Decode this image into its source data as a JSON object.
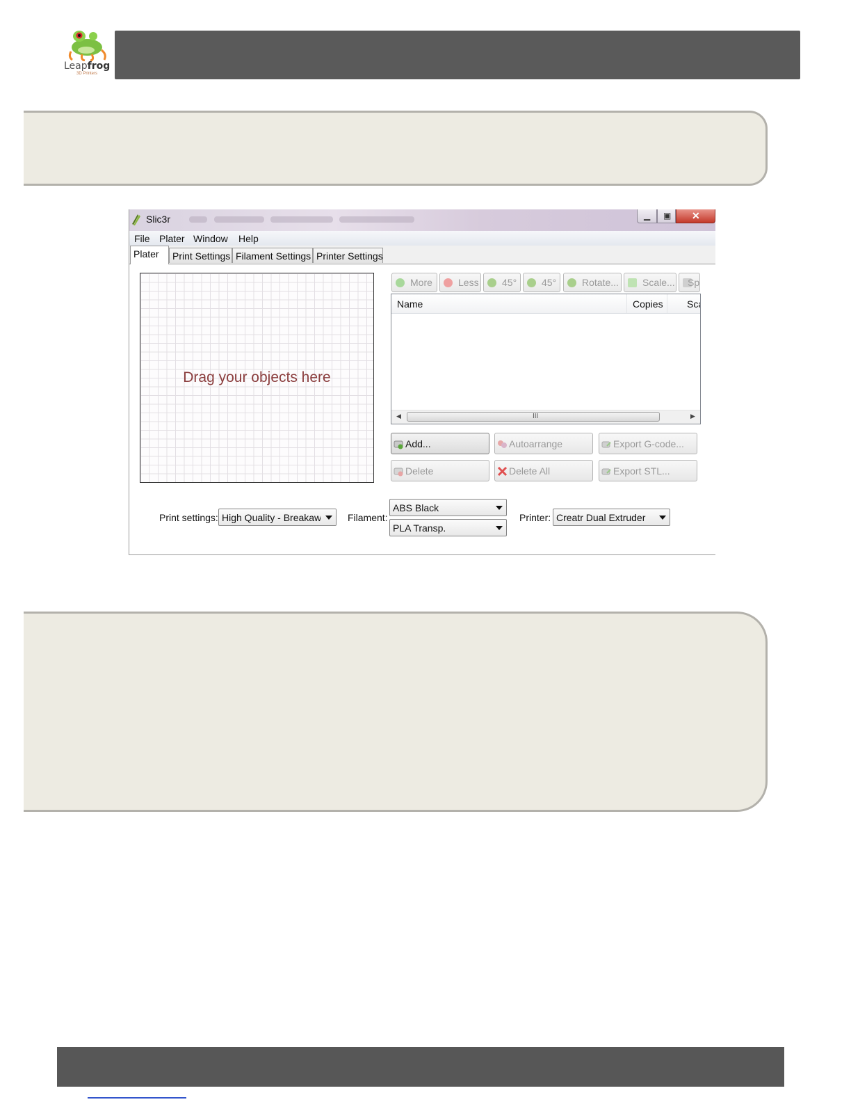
{
  "document": {
    "logo": {
      "brand_light": "Leap",
      "brand_bold": "frog",
      "tagline": "3D Printers"
    }
  },
  "window": {
    "title": "Slic3r",
    "controls": {
      "close": "✕"
    },
    "menu": [
      "File",
      "Plater",
      "Window",
      "Help"
    ],
    "tabs": [
      "Plater",
      "Print Settings",
      "Filament Settings",
      "Printer Settings"
    ],
    "active_tab": "Plater"
  },
  "plater": {
    "bed_hint": "Drag your objects here",
    "toolbar": [
      {
        "label": "More",
        "icon": "plus-circle-icon"
      },
      {
        "label": "Less",
        "icon": "minus-circle-icon"
      },
      {
        "label": "45°",
        "icon": "rotate-left-icon"
      },
      {
        "label": "45°",
        "icon": "rotate-right-icon"
      },
      {
        "label": "Rotate...",
        "icon": "rotate-icon"
      },
      {
        "label": "Scale...",
        "icon": "scale-icon"
      },
      {
        "label": "Split",
        "icon": "split-icon"
      }
    ],
    "object_list": {
      "columns": [
        "Name",
        "Copies",
        "Scale"
      ],
      "rows": [],
      "scroll_grip": "III"
    },
    "actions": [
      {
        "label": "Add...",
        "icon": "add-brick-icon",
        "enabled": true
      },
      {
        "label": "Autoarrange",
        "icon": "arrange-icon",
        "enabled": false
      },
      {
        "label": "Export G-code...",
        "icon": "export-gcode-icon",
        "enabled": false
      },
      {
        "label": "Delete",
        "icon": "delete-brick-icon",
        "enabled": false
      },
      {
        "label": "Delete All",
        "icon": "delete-all-icon",
        "enabled": false
      },
      {
        "label": "Export STL...",
        "icon": "export-stl-icon",
        "enabled": false
      }
    ],
    "presets": {
      "print_label": "Print settings:",
      "print_value": "High Quality - Breakaway",
      "filament_label": "Filament:",
      "filament_values": [
        "ABS Black",
        "PLA Transp."
      ],
      "printer_label": "Printer:",
      "printer_value": "Creatr Dual Extruder"
    }
  },
  "colors": {
    "header_bar": "#5a5a5a",
    "callout_fill": "#edebe2",
    "callout_border": "#b3b1ab",
    "bed_hint_text": "#8b3e3e",
    "close_button": "#c4392b"
  }
}
